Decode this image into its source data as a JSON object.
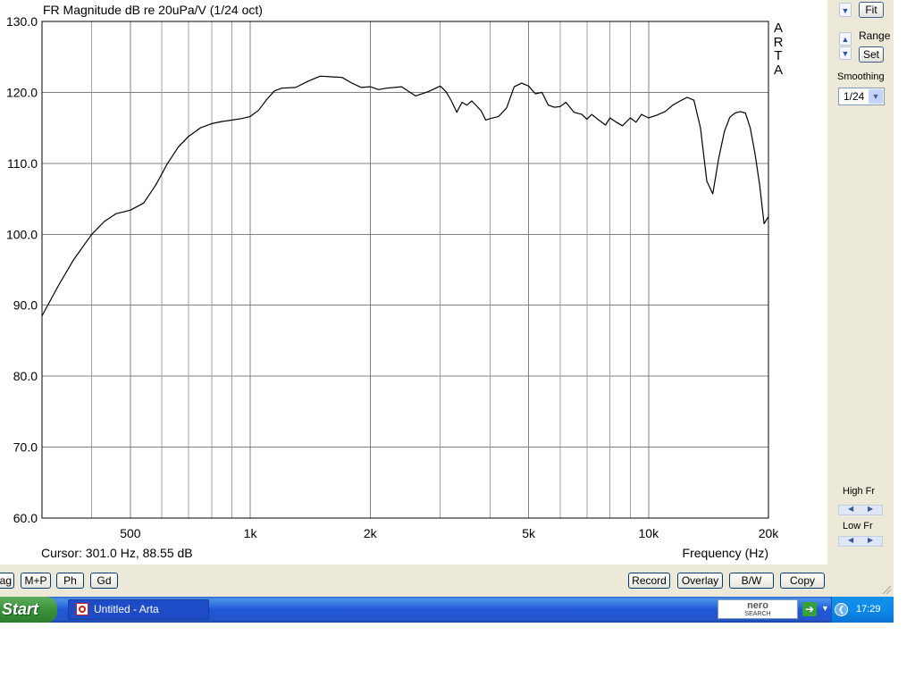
{
  "window": {
    "plot_title": "FR Magnitude dB re 20uPa/V (1/24 oct)",
    "brand_letters": [
      "A",
      "R",
      "T",
      "A"
    ],
    "cursor_readout": "Cursor: 301.0 Hz, 88.55 dB",
    "x_axis_label": "Frequency (Hz)"
  },
  "right_panel": {
    "fit_label": "Fit",
    "range_label": "Range",
    "set_label": "Set",
    "smoothing_label": "Smoothing",
    "smoothing_value": "1/24",
    "high_fr_label": "High Fr",
    "low_fr_label": "Low Fr"
  },
  "bottom_buttons": {
    "left": [
      "ag",
      "M+P",
      "Ph",
      "Gd"
    ],
    "right": [
      "Record",
      "Overlay",
      "B/W",
      "Copy"
    ]
  },
  "taskbar": {
    "start_label": "Start",
    "task_label": "Untitled - Arta",
    "search_brand_top": "nero",
    "search_brand_bottom": "SEARCH",
    "clock": "17:29"
  },
  "colors": {
    "plot_background": "#ffffff",
    "grid": "#808080",
    "trace": "#000000",
    "window_face": "#ece9d8",
    "taskbar_blue": "#245edb",
    "start_green": "#3c943c"
  },
  "chart_data": {
    "type": "line",
    "title": "FR Magnitude dB re 20uPa/V (1/24 oct)",
    "xlabel": "Frequency (Hz)",
    "ylabel": "",
    "x_scale": "log",
    "xlim": [
      300,
      20000
    ],
    "ylim": [
      60,
      130
    ],
    "grid": true,
    "x_tick_labels": [
      {
        "value": 500,
        "label": "500"
      },
      {
        "value": 1000,
        "label": "1k"
      },
      {
        "value": 2000,
        "label": "2k"
      },
      {
        "value": 5000,
        "label": "5k"
      },
      {
        "value": 10000,
        "label": "10k"
      },
      {
        "value": 20000,
        "label": "20k"
      }
    ],
    "x_minor_gridlines": [
      400,
      600,
      700,
      800,
      900,
      3000,
      4000,
      6000,
      7000,
      8000,
      9000
    ],
    "y_ticks": [
      {
        "value": 60,
        "label": "60.0"
      },
      {
        "value": 70,
        "label": "70.0"
      },
      {
        "value": 80,
        "label": "80.0"
      },
      {
        "value": 90,
        "label": "90.0"
      },
      {
        "value": 100,
        "label": "100.0"
      },
      {
        "value": 110,
        "label": "110.0"
      },
      {
        "value": 120,
        "label": "120.0"
      },
      {
        "value": 130,
        "label": "130.0"
      }
    ],
    "series": [
      {
        "x": [
          300,
          330,
          360,
          400,
          430,
          460,
          500,
          540,
          580,
          620,
          660,
          700,
          750,
          800,
          850,
          900,
          950,
          1000,
          1050,
          1100,
          1150,
          1200,
          1300,
          1400,
          1500,
          1600,
          1700,
          1800,
          1900,
          2000,
          2100,
          2200,
          2400,
          2600,
          2800,
          3000,
          3100,
          3200,
          3300,
          3400,
          3500,
          3600,
          3700,
          3800,
          3900,
          4000,
          4200,
          4400,
          4600,
          4800,
          5000,
          5200,
          5400,
          5600,
          5800,
          6000,
          6200,
          6500,
          6800,
          7000,
          7200,
          7500,
          7800,
          8000,
          8300,
          8600,
          9000,
          9300,
          9600,
          10000,
          10500,
          11000,
          11500,
          12000,
          12500,
          13000,
          13500,
          14000,
          14500,
          15000,
          15500,
          16000,
          16500,
          17000,
          17500,
          18000,
          18500,
          19000,
          19500,
          20000
        ],
        "y": [
          88.5,
          92.8,
          96.4,
          100.0,
          101.8,
          102.9,
          103.4,
          104.4,
          107.0,
          110.0,
          112.3,
          113.8,
          115.0,
          115.6,
          115.9,
          116.1,
          116.3,
          116.6,
          117.5,
          119.0,
          120.2,
          120.6,
          120.7,
          121.6,
          122.3,
          122.2,
          122.1,
          121.3,
          120.7,
          120.8,
          120.4,
          120.6,
          120.8,
          119.5,
          120.1,
          120.9,
          120.1,
          118.8,
          117.2,
          118.6,
          118.2,
          118.8,
          118.1,
          117.4,
          116.1,
          116.3,
          116.6,
          117.8,
          120.8,
          121.3,
          120.9,
          119.8,
          120.0,
          118.2,
          117.9,
          118.0,
          118.6,
          117.2,
          116.9,
          116.2,
          116.9,
          116.1,
          115.4,
          116.4,
          115.8,
          115.3,
          116.4,
          115.8,
          116.9,
          116.4,
          116.8,
          117.3,
          118.2,
          118.8,
          119.3,
          118.9,
          115.0,
          107.5,
          105.7,
          110.7,
          114.5,
          116.5,
          117.1,
          117.3,
          117.1,
          115.0,
          111.4,
          107.0,
          101.5,
          102.5
        ]
      }
    ]
  }
}
